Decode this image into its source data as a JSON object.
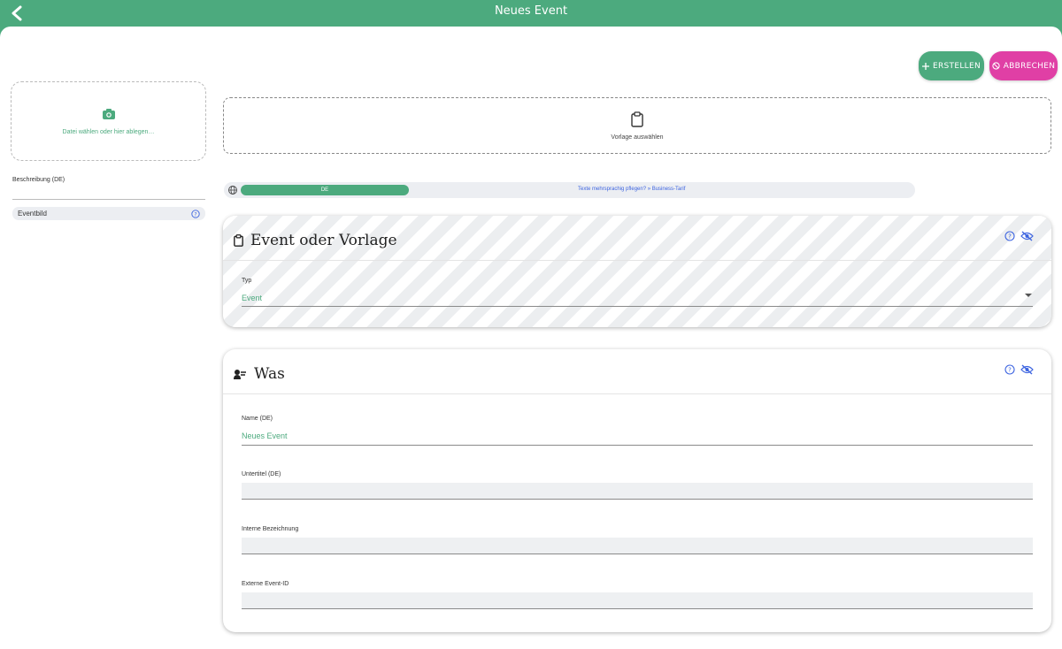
{
  "topbar": {
    "title": "Neues Event"
  },
  "actions": {
    "create_label": "ERSTELLEN",
    "cancel_label": "ABBRECHEN"
  },
  "sidebar": {
    "dropzone_text": "Datei wählen oder hier ablegen…",
    "description_label": "Beschreibung (DE)",
    "eventbild_label": "Eventbild"
  },
  "template": {
    "label": "Vorlage auswählen"
  },
  "language": {
    "active_tab": "DE",
    "info_text": "Texte mehrsprachig pflegen? » Business-Tarif"
  },
  "card_type": {
    "title": "Event oder Vorlage",
    "type_label": "Typ",
    "type_value": "Event"
  },
  "card_what": {
    "title": "Was",
    "name_label": "Name (DE)",
    "name_value": "Neues Event",
    "subtitle_label": "Untertitel (DE)",
    "internal_label": "Interne Bezeichnung",
    "external_label": "Externe Event-ID"
  },
  "colors": {
    "accent": "#4caa7e",
    "cancel": "#e03fa5",
    "link": "#3d64e0"
  }
}
